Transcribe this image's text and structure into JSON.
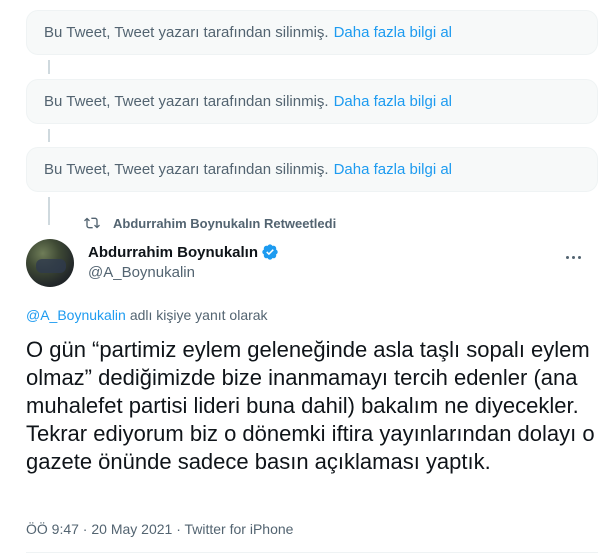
{
  "deleted_notices": [
    {
      "text": "Bu Tweet, Tweet yazarı tarafından silinmiş.",
      "link": "Daha fazla bilgi al"
    },
    {
      "text": "Bu Tweet, Tweet yazarı tarafından silinmiş.",
      "link": "Daha fazla bilgi al"
    },
    {
      "text": "Bu Tweet, Tweet yazarı tarafından silinmiş.",
      "link": "Daha fazla bilgi al"
    }
  ],
  "retweet": {
    "label": "Abdurrahim Boynukalın Retweetledi",
    "icon": "retweet-icon"
  },
  "author": {
    "display_name": "Abdurrahim Boynukalın",
    "handle": "@A_Boynukalin",
    "verified": true
  },
  "reply": {
    "mention": "@A_Boynukalin",
    "suffix": "adlı kişiye yanıt olarak"
  },
  "tweet": {
    "text": "O gün “partimiz eylem geleneğinde asla taşlı sopalı eylem olmaz” dediğimizde bize inanmamayı tercih edenler (ana muhalefet partisi lideri buna dahil) bakalım ne diyecekler. Tekrar ediyorum biz o dönemki iftira yayınlarından dolayı o gazete önünde sadece basın açıklaması yaptık."
  },
  "meta": {
    "text": "ÖÖ 9:47 · 20 May 2021 · Twitter for iPhone"
  },
  "colors": {
    "accent": "#1d9bf0",
    "secondary_text": "#536471",
    "primary_text": "#0f1419",
    "thread_line": "#cfd9de"
  }
}
